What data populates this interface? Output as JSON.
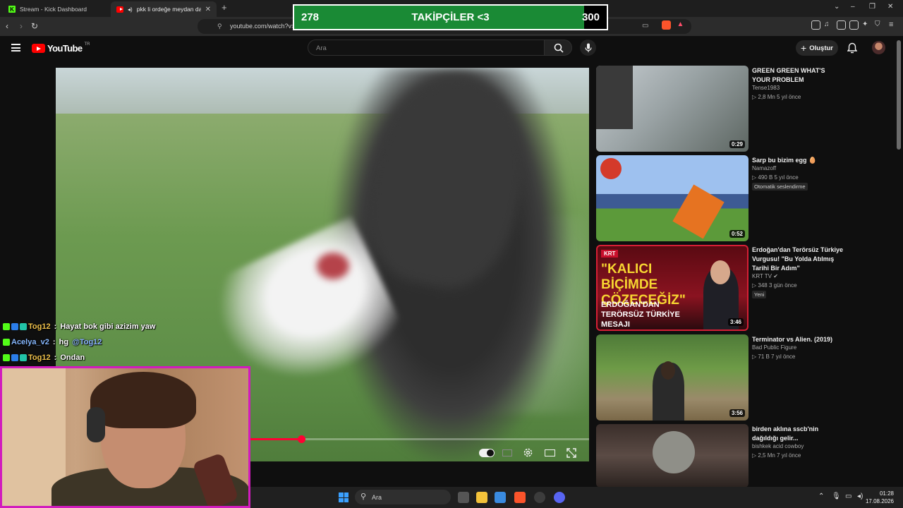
{
  "browser": {
    "tabs": [
      {
        "label": "Stream - Kick Dashboard"
      },
      {
        "label": "pkk li ordeğe meydan dayağı"
      }
    ],
    "url": "youtube.com/watch?v="
  },
  "youtube": {
    "logo_text": "YouTube",
    "region": "TR",
    "search_placeholder": "Ara",
    "create_label": "Oluştur"
  },
  "goal": {
    "current": "278",
    "title": "TAKİPÇİLER <3",
    "target": "300",
    "progress_fraction": 0.927
  },
  "video": {
    "played_fraction": 0.46
  },
  "recommendations": [
    {
      "title": "GREEN GREEN WHAT'S YOUR PROBLEM",
      "channel": "Tense1983",
      "meta": "▷ 2,8 Mn  5 yıl önce",
      "duration": "0:29",
      "badge": ""
    },
    {
      "title": "Sarp bu bizim egg 🥚",
      "channel": "Namazoff",
      "meta": "▷ 490 B  5 yıl önce",
      "duration": "0:52",
      "badge": "Otomatik seslendirme"
    },
    {
      "title": "Erdoğan'dan Terörsüz Türkiye Vurgusu! \"Bu Yolda Atılmış Tarihi Bir Adım\"",
      "channel": "KRT TV ✔",
      "meta": "▷ 348  3 gün önce",
      "duration": "3:46",
      "badge": "Yeni",
      "thumb_logo": "KRT",
      "thumb_headline": "\"KALICI BİÇİMDE ÇÖZECEĞİZ\"",
      "thumb_sub": "ERDOĞAN'DAN TERÖRSÜZ TÜRKİYE MESAJI"
    },
    {
      "title": "Terminator vs Alien. (2019)",
      "channel": "Bad Public Figure",
      "meta": "▷ 71 B  7 yıl önce",
      "duration": "3:56",
      "badge": ""
    },
    {
      "title": "birden aklına sscb'nin dağıldığı gelir...",
      "channel": "bishkek acid cowboy",
      "meta": "▷ 2,5 Mn  7 yıl önce",
      "duration": "",
      "badge": ""
    }
  ],
  "chat": [
    {
      "user": "Tog12",
      "sep": " : ",
      "message": "Hayat bok gibi azizim yaw"
    },
    {
      "user": "Acelya_v2",
      "sep": " : ",
      "message": "hg ",
      "mention": "@Tog12"
    },
    {
      "user": "Tog12",
      "sep": " : ",
      "message": "Ondan"
    }
  ],
  "taskbar": {
    "search_placeholder": "Ara",
    "time": "01:28",
    "date": "17.08.2026"
  },
  "colors": {
    "goal_fill": "#1a8a35",
    "webcam_border": "#d21bbe",
    "progress": "#ff0033"
  }
}
